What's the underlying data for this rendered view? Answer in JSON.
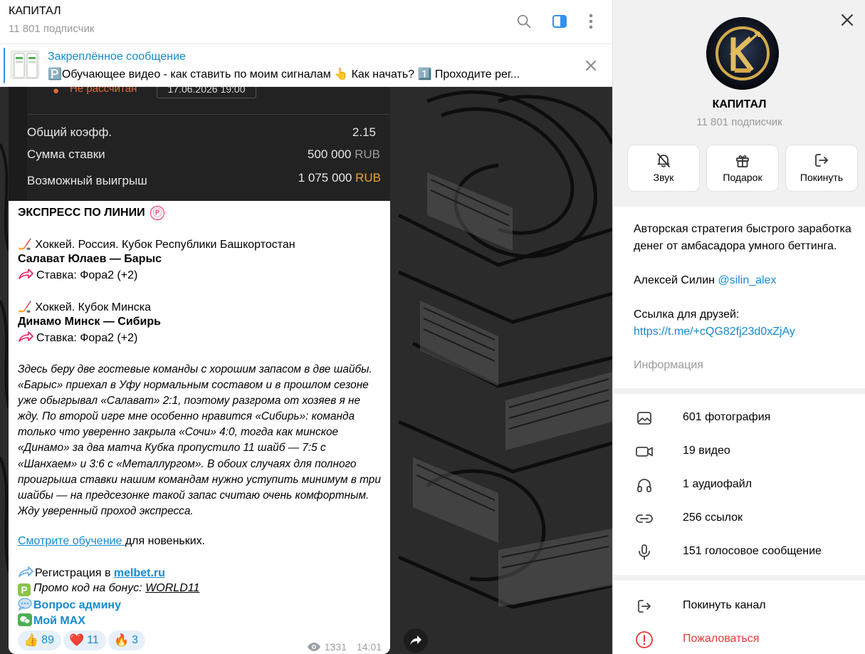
{
  "header": {
    "title": "КАПИТАЛ",
    "subscribers": "11 801 подписчик"
  },
  "pinned": {
    "title": "Закреплённое сообщение",
    "text": "🅿️Обучающее видео - как ставить по моим сигналам 👆  Как начать?  1️⃣ Проходите рег..."
  },
  "bet_card": {
    "status": "Не рассчитан",
    "date": "17.06.2026 19:00",
    "total_coef_label": "Общий коэфф.",
    "total_coef_value": "2.15",
    "stake_label": "Сумма ставки",
    "stake_value": "500 000",
    "win_label": "Возможный выигрыш",
    "win_value": "1 075 000",
    "currency": "RUB"
  },
  "message": {
    "headline": "ЭКСПРЕСС ПО ЛИНИИ",
    "headline_icon": "Ⓟ",
    "match1_league": "🏒 Хоккей. Россия. Кубок Республики Башкортостан",
    "match1_teams": "Салават Юлаев — Барыс",
    "match1_bet": "Ставка: Фора2 (+2)",
    "match2_league": "🏒 Хоккей. Кубок Минска",
    "match2_teams": "Динамо Минск — Сибирь",
    "match2_bet": "Ставка: Фора2 (+2)",
    "analysis": "Здесь беру две гостевые команды с хорошим запасом в две шайбы. «Барыс» приехал в Уфу нормальным составом и в прошлом сезоне уже обыгрывал «Салават» 2:1, поэтому разгрома от хозяев я не жду. По второй игре мне особенно нравится «Сибирь»: команда только что уверенно закрыла «Сочи» 4:0, тогда как минское «Динамо» за два матча Кубка пропустило 11 шайб — 7:5 с «Шанхаем» и 3:6 с «Металлургом». В обоих случаях для полного проигрыша ставки нашим командам нужно уступить минимум в три шайбы — на предсезонке такой запас считаю очень комфортным. Жду уверенный проход экспресса.",
    "watch_link": "Смотрите обучение ",
    "watch_suffix": "для новеньких.",
    "reg_prefix": "Регистрация в ",
    "reg_link": "melbet.ru",
    "promo_prefix": "Промо код на бонус: ",
    "promo_code": "WORLD11",
    "admin_link": "Вопрос админу",
    "max_link": "Мой MAX",
    "reactions": [
      {
        "emoji": "👍",
        "count": "89"
      },
      {
        "emoji": "❤️",
        "count": "11"
      },
      {
        "emoji": "🔥",
        "count": "3"
      }
    ],
    "views": "1331",
    "time": "14:01"
  },
  "panel": {
    "name": "КАПИТАЛ",
    "subscribers": "11 801 подписчик",
    "buttons": {
      "sound": "Звук",
      "gift": "Подарок",
      "leave": "Покинуть"
    },
    "description": "Авторская стратегия быстрого заработка денег от амбасадора умного беттинга.",
    "author_name": "Алексей Силин ",
    "author_handle": "@silin_alex",
    "friends_label": "Ссылка для друзей:",
    "friends_link": "https://t.me/+cQG82fj23d0xZjAy",
    "info_label": "Информация",
    "media": {
      "photos": "601 фотография",
      "videos": "19 видео",
      "audio": "1 аудиофайл",
      "links": "256 ссылок",
      "voice": "151 голосовое сообщение"
    },
    "leave_channel": "Покинуть канал",
    "report": "Пожаловаться"
  },
  "colors": {
    "accent": "#168acd",
    "danger": "#e53935",
    "rub": "#e8a33a"
  }
}
